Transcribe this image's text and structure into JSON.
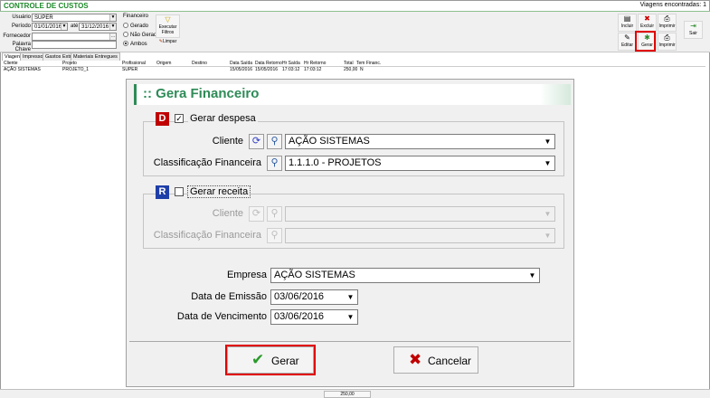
{
  "app": {
    "title": "CONTROLE DE CUSTOS",
    "counter": "Viagens encontradas: 1"
  },
  "filters": {
    "usuario_label": "Usuário",
    "usuario_value": "SUPER",
    "periodo_label": "Período",
    "periodo_from": "01/01/2016",
    "periodo_ate": "até",
    "periodo_to": "31/12/2016",
    "fornecedor_label": "Fornecedor",
    "fornecedor_value": "",
    "palavra_label": "Palavra Chave",
    "palavra_value": "",
    "financeiro_label": "Financeiro",
    "options": [
      "Gerado",
      "Não Gerado",
      "Ambos"
    ],
    "selected_option": "Ambos",
    "executar_label": "Executar Filtros",
    "limpar_label": "Limpar"
  },
  "toolbar": {
    "incluir": "Incluir",
    "excluir": "Excluir",
    "imprimir": "Imprimir",
    "editar": "Editar",
    "gerar": "Gerar",
    "imprimir2": "Imprimir",
    "sair": "Sair"
  },
  "tabs": [
    "Viagens",
    "Impressos",
    "Gastos Extras",
    "Materiais Entregues"
  ],
  "grid": {
    "columns": [
      "Cliente",
      "Projeto",
      "Profissional",
      "Origem",
      "Destino",
      "Data Saída",
      "Data Retorno",
      "Hr Saída",
      "Hr Retorno",
      "Total",
      "Tem Financ."
    ],
    "rows": [
      [
        "AÇÃO SISTEMAS",
        "PROJETO_1",
        "SUPER",
        "",
        "",
        "15/05/2016",
        "15/05/2016",
        "17:03:12",
        "17:03:12",
        "250,00",
        "N"
      ]
    ]
  },
  "status": {
    "total": "250,00"
  },
  "modal": {
    "title": ":: Gera Financeiro",
    "despesa": {
      "badge": "D",
      "checked": true,
      "title": "Gerar despesa",
      "cliente_label": "Cliente",
      "cliente_value": "AÇÃO SISTEMAS",
      "classificacao_label": "Classificação Financeira",
      "classificacao_value": "1.1.1.0 - PROJETOS"
    },
    "receita": {
      "badge": "R",
      "checked": false,
      "title": "Gerar receita",
      "cliente_label": "Cliente",
      "cliente_value": "",
      "classificacao_label": "Classificação Financeira",
      "classificacao_value": ""
    },
    "empresa_label": "Empresa",
    "empresa_value": "AÇÃO SISTEMAS",
    "emissao_label": "Data de Emissão",
    "emissao_value": "03/06/2016",
    "vencimento_label": "Data de Vencimento",
    "vencimento_value": "03/06/2016",
    "gerar_label": "Gerar",
    "cancelar_label": "Cancelar"
  },
  "colors": {
    "title_green": "#1d8a2a",
    "modal_accent": "#2e8b57",
    "badge_despesa": "#c00000",
    "badge_receita": "#1f3fa8",
    "highlight": "#e00000"
  },
  "icons": {
    "gerar_button": "check-icon",
    "cancelar_button": "x-icon",
    "search": "magnifier-icon",
    "refresh": "refresh-icon"
  }
}
